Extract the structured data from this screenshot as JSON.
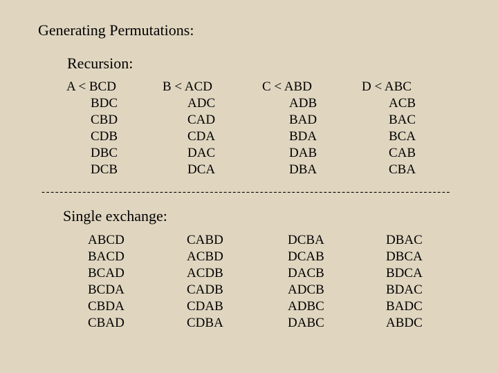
{
  "title": "Generating Permutations:",
  "recursion": {
    "heading": "Recursion:",
    "columns": [
      {
        "header": "A < BCD",
        "items": [
          "BDC",
          "CBD",
          "CDB",
          "DBC",
          "DCB"
        ]
      },
      {
        "header": "B < ACD",
        "items": [
          "ADC",
          "CAD",
          "CDA",
          "DAC",
          "DCA"
        ]
      },
      {
        "header": "C < ABD",
        "items": [
          "ADB",
          "BAD",
          "BDA",
          "DAB",
          "DBA"
        ]
      },
      {
        "header": "D < ABC",
        "items": [
          "ACB",
          "BAC",
          "BCA",
          "CAB",
          "CBA"
        ]
      }
    ]
  },
  "divider": "------------------------------------------------------------------------------------------",
  "single_exchange": {
    "heading": "Single exchange:",
    "columns": [
      [
        "ABCD",
        "BACD",
        "BCAD",
        "BCDA",
        "CBDA",
        "CBAD"
      ],
      [
        "CABD",
        "ACBD",
        "ACDB",
        "CADB",
        "CDAB",
        "CDBA"
      ],
      [
        "DCBA",
        "DCAB",
        "DACB",
        "ADCB",
        "ADBC",
        "DABC"
      ],
      [
        "DBAC",
        "DBCA",
        "BDCA",
        "BDAC",
        "BADC",
        "ABDC"
      ]
    ]
  }
}
